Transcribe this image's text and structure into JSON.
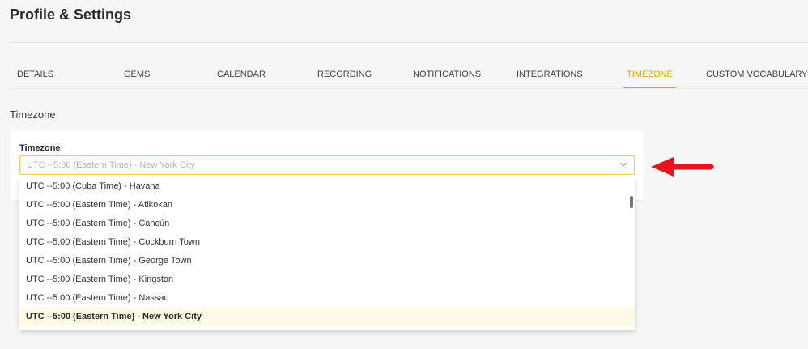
{
  "header": {
    "title": "Profile & Settings"
  },
  "tabs": [
    {
      "label": "DETAILS"
    },
    {
      "label": "GEMS"
    },
    {
      "label": "CALENDAR"
    },
    {
      "label": "RECORDING"
    },
    {
      "label": "NOTIFICATIONS"
    },
    {
      "label": "INTEGRATIONS"
    },
    {
      "label": "TIMEZONE",
      "active": true
    },
    {
      "label": "CUSTOM VOCABULARY"
    }
  ],
  "section": {
    "title": "Timezone"
  },
  "timezone_field": {
    "label": "Timezone",
    "value": "UTC --5:00 (Eastern Time) - New York City",
    "options": [
      "UTC --5:00 (Cuba Time) - Havana",
      "UTC --5:00 (Eastern Time) - Atikokan",
      "UTC --5:00 (Eastern Time) - Cancún",
      "UTC --5:00 (Eastern Time) - Cockburn Town",
      "UTC --5:00 (Eastern Time) - George Town",
      "UTC --5:00 (Eastern Time) - Kingston",
      "UTC --5:00 (Eastern Time) - Nassau",
      "UTC --5:00 (Eastern Time) - New York City"
    ],
    "selected_option": "UTC --5:00 (Eastern Time) - New York City"
  },
  "colors": {
    "accent": "#e8a800",
    "selected_bg": "#fffae6",
    "annotation_arrow": "#e8141b"
  },
  "icons": {
    "select_chevron": "chevron-down-icon",
    "annotation": "red-arrow-left-icon"
  }
}
